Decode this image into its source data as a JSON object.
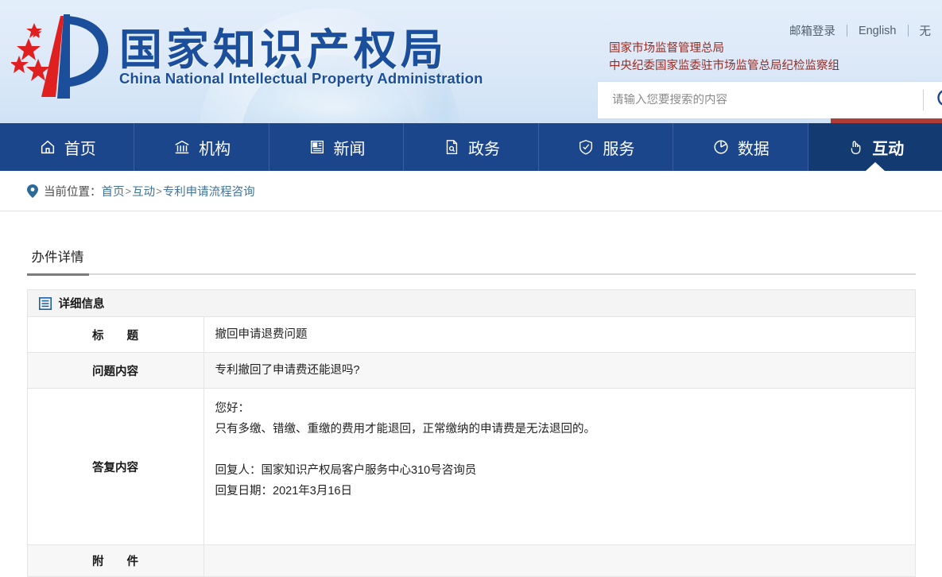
{
  "header": {
    "logo_cn": "国家知识产权局",
    "logo_en": "China National Intellectual Property Administration",
    "top_links": [
      {
        "label": "邮箱登录"
      },
      {
        "label": "English"
      },
      {
        "label": "无"
      }
    ],
    "org_line_1": "国家市场监督管理总局",
    "org_line_2": "中央纪委国家监委驻市场监管总局纪检监察组",
    "search": {
      "placeholder": "请输入您要搜索的内容",
      "value": "",
      "icon": "search-icon"
    },
    "accent_red": "#b03c37",
    "brand_blue": "#1b468c"
  },
  "nav": {
    "items": [
      {
        "label": "首页",
        "icon": "home-icon",
        "active": false
      },
      {
        "label": "机构",
        "icon": "bank-icon",
        "active": false
      },
      {
        "label": "新闻",
        "icon": "newspaper-icon",
        "active": false
      },
      {
        "label": "政务",
        "icon": "document-icon",
        "active": false
      },
      {
        "label": "服务",
        "icon": "shield-check-icon",
        "active": false
      },
      {
        "label": "数据",
        "icon": "pie-chart-icon",
        "active": false
      },
      {
        "label": "互动",
        "icon": "hand-pointer-icon",
        "active": true
      }
    ]
  },
  "breadcrumb": {
    "icon": "location-pin-icon",
    "label": "当前位置：",
    "items": [
      "首页",
      "互动",
      "专利申请流程咨询"
    ],
    "separator": ">"
  },
  "main": {
    "tab": "办件详情",
    "section_title": "详细信息",
    "section_icon": "list-panel-icon",
    "rows": [
      {
        "label": "标　　题",
        "value": "撤回申请退费问题",
        "type": "single"
      },
      {
        "label": "问题内容",
        "value": "专利撤回了申请费还能退吗?",
        "type": "single"
      },
      {
        "label": "答复内容",
        "type": "multi",
        "lines": [
          "您好：",
          "只有多缴、错缴、重缴的费用才能退回，正常缴纳的申请费是无法退回的。",
          "",
          "回复人：国家知识产权局客户服务中心310号咨询员",
          "回复日期：2021年3月16日"
        ]
      },
      {
        "label": "附　　件",
        "value": "",
        "type": "single"
      }
    ]
  }
}
